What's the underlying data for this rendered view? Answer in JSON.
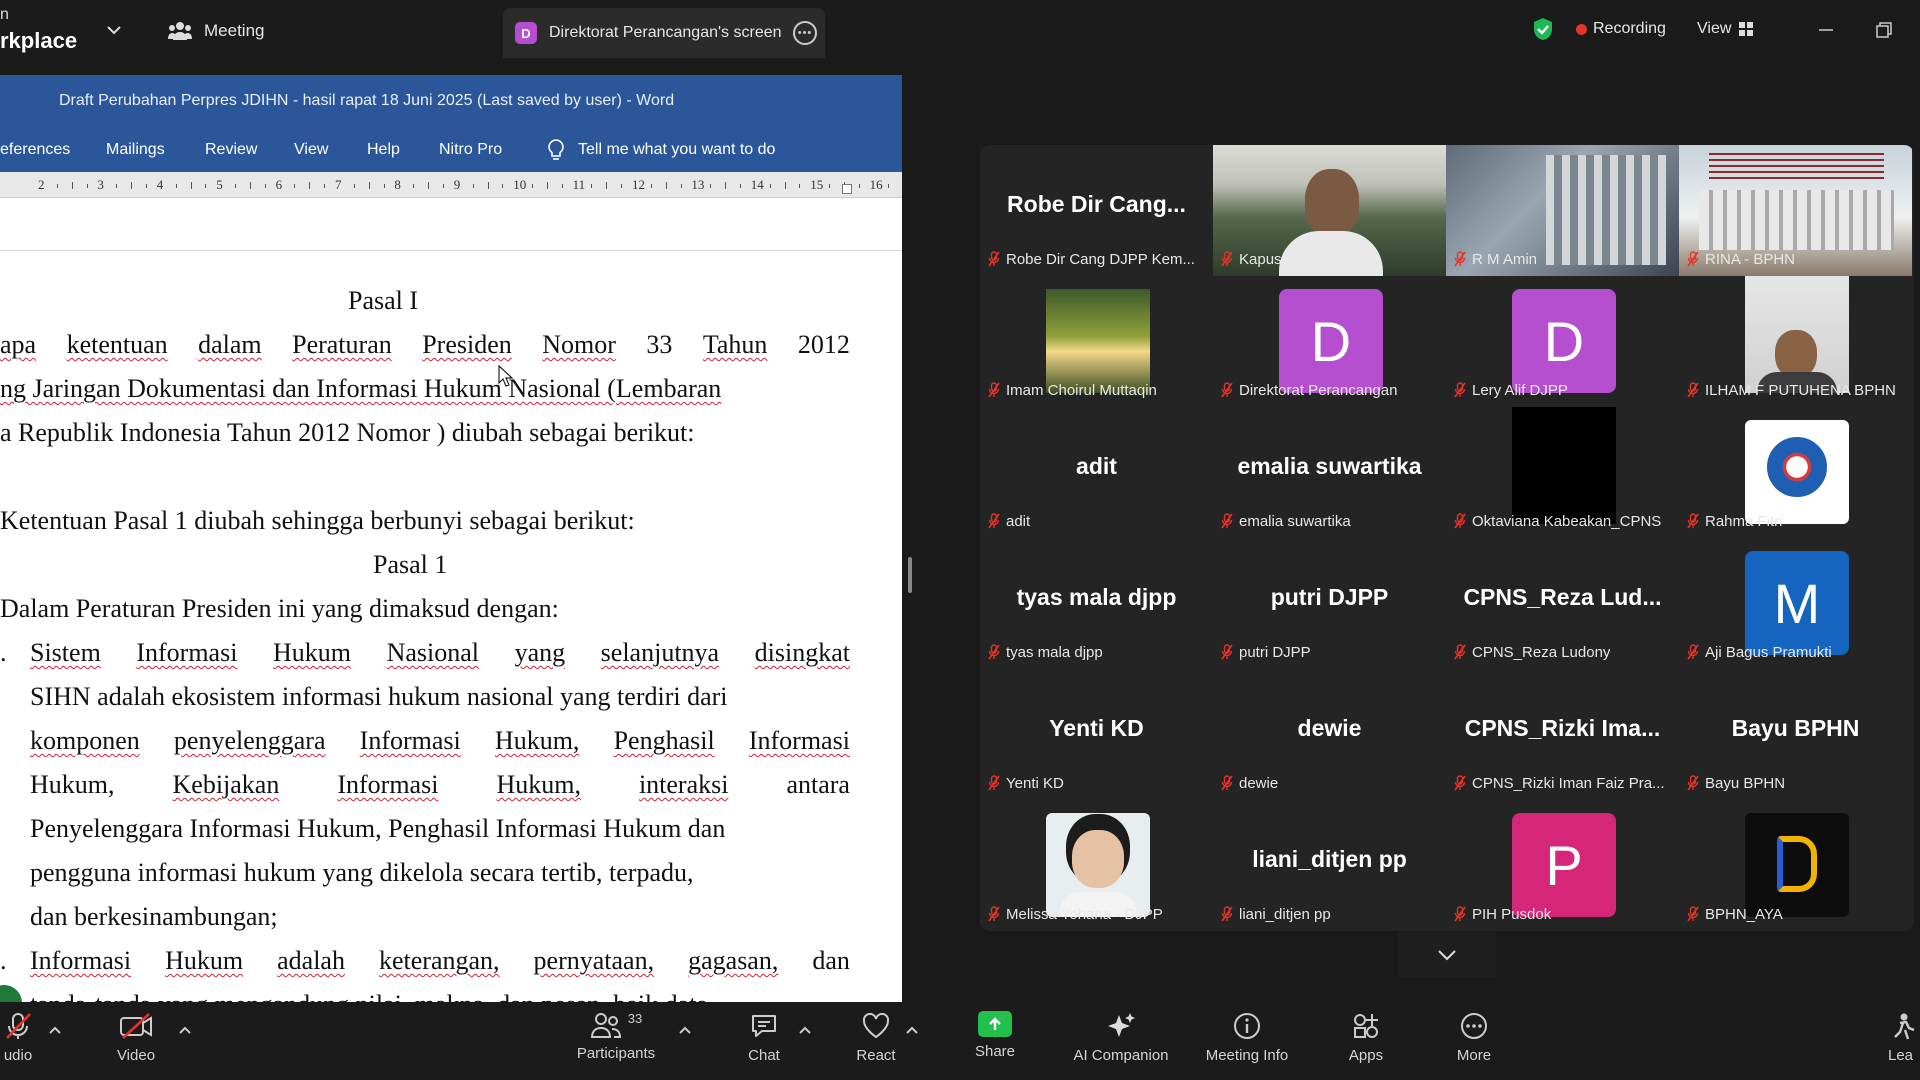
{
  "topbar": {
    "app_line1": "n",
    "app_line2": "rkplace",
    "meeting_label": "Meeting",
    "share_tab_badge": "D",
    "share_tab_label": "Direktorat Perancangan's screen",
    "recording_label": "Recording",
    "view_label": "View"
  },
  "word": {
    "title": "Draft Perubahan Perpres JDIHN - hasil rapat 18 Juni 2025 (Last saved by user)  -  Word",
    "ribbon_tabs": [
      "eferences",
      "Mailings",
      "Review",
      "View",
      "Help",
      "Nitro Pro"
    ],
    "tell_me": "Tell me what you want to do",
    "ruler_numbers": [
      "2",
      "3",
      "4",
      "5",
      "6",
      "7",
      "8",
      "9",
      "10",
      "11",
      "12",
      "13",
      "14",
      "15",
      "16"
    ],
    "doc": {
      "heading1": "Pasal I",
      "p1_line1": [
        "apa",
        "ketentuan",
        "dalam",
        "Peraturan",
        "Presiden",
        "Nomor",
        "33",
        "Tahun",
        "2012"
      ],
      "p1_line2": "ng Jaringan Dokumentasi dan Informasi Hukum Nasional (Lembaran",
      "p1_line3": "a Republik Indonesia Tahun 2012 Nomor ) diubah sebagai berikut:",
      "p2": "Ketentuan Pasal 1 diubah sehingga berbunyi sebagai berikut:",
      "heading2": "Pasal 1",
      "p3": "Dalam Peraturan Presiden ini yang dimaksud dengan:",
      "item1_l1": [
        "Sistem",
        "Informasi",
        "Hukum",
        "Nasional",
        "yang",
        "selanjutnya",
        "disingkat"
      ],
      "item1_l2": "SIHN adalah ekosistem informasi hukum nasional yang terdiri dari",
      "item1_l3": [
        "komponen",
        "penyelenggara",
        "Informasi",
        "Hukum,",
        "Penghasil",
        "Informasi"
      ],
      "item1_l4": [
        "Hukum,",
        "Kebijakan",
        "Informasi",
        "Hukum,",
        "interaksi",
        "antara"
      ],
      "item1_l5": "Penyelenggara Informasi Hukum, Penghasil Informasi Hukum dan",
      "item1_l6": "pengguna informasi hukum yang dikelola secara tertib, terpadu,",
      "item1_l7": "dan berkesinambungan;",
      "item2_l1": [
        "Informasi",
        "Hukum",
        "adalah",
        "keterangan,",
        "pernyataan,",
        "gagasan,",
        "dan"
      ],
      "item2_l2": "tanda-tanda yang mengandung nilai, makna, dan pesan, baik data,"
    }
  },
  "gallery": {
    "tiles": [
      {
        "big": "Robe Dir Cang...",
        "label": "Robe Dir Cang DJPP Kem..."
      },
      {
        "big": "",
        "label": "Kapus LLHPJDIHN"
      },
      {
        "big": "",
        "label": "R M Amin"
      },
      {
        "big": "",
        "label": "RINA - BPHN"
      },
      {
        "big": "",
        "label": "Imam Choirul Muttaqin"
      },
      {
        "big": "D",
        "label": "Direktorat Perancangan"
      },
      {
        "big": "D",
        "label": "Lery Alif DJPP"
      },
      {
        "big": "",
        "label": "ILHAM F PUTUHENA BPHN"
      },
      {
        "big": "adit",
        "label": "adit"
      },
      {
        "big": "emalia suwartika",
        "label": "emalia suwartika"
      },
      {
        "big": "",
        "label": "Oktaviana Kabeakan_CPNS"
      },
      {
        "big": "",
        "label": "Rahma Fitri"
      },
      {
        "big": "tyas mala djpp",
        "label": "tyas mala djpp"
      },
      {
        "big": "putri DJPP",
        "label": "putri DJPP"
      },
      {
        "big": "CPNS_Reza Lud...",
        "label": "CPNS_Reza Ludony"
      },
      {
        "big": "M",
        "label": "Aji Bagus Pramukti"
      },
      {
        "big": "Yenti KD",
        "label": "Yenti KD"
      },
      {
        "big": "dewie",
        "label": "dewie"
      },
      {
        "big": "CPNS_Rizki Ima...",
        "label": "CPNS_Rizki Iman Faiz Pra..."
      },
      {
        "big": "Bayu BPHN",
        "label": "Bayu BPHN"
      },
      {
        "big": "",
        "label": "Melissa Yohana - DJPP"
      },
      {
        "big": "liani_ditjen pp",
        "label": "liani_ditjen pp"
      },
      {
        "big": "P",
        "label": "PIH Pusdok"
      },
      {
        "big": "",
        "label": "BPHN_AYA"
      }
    ]
  },
  "toolbar": {
    "audio": "udio",
    "video": "Video",
    "participants": "Participants",
    "participants_count": "33",
    "chat": "Chat",
    "react": "React",
    "share": "Share",
    "ai": "AI Companion",
    "info": "Meeting Info",
    "apps": "Apps",
    "more": "More",
    "leave": "Lea"
  },
  "colors": {
    "word_blue": "#2b579a",
    "recording_red": "#e5332a",
    "active_speaker_green": "#2bd15a",
    "share_green": "#23c04d",
    "avatar_purple": "#b54fd0",
    "avatar_pink": "#d6267a",
    "avatar_blue": "#1565c0"
  }
}
